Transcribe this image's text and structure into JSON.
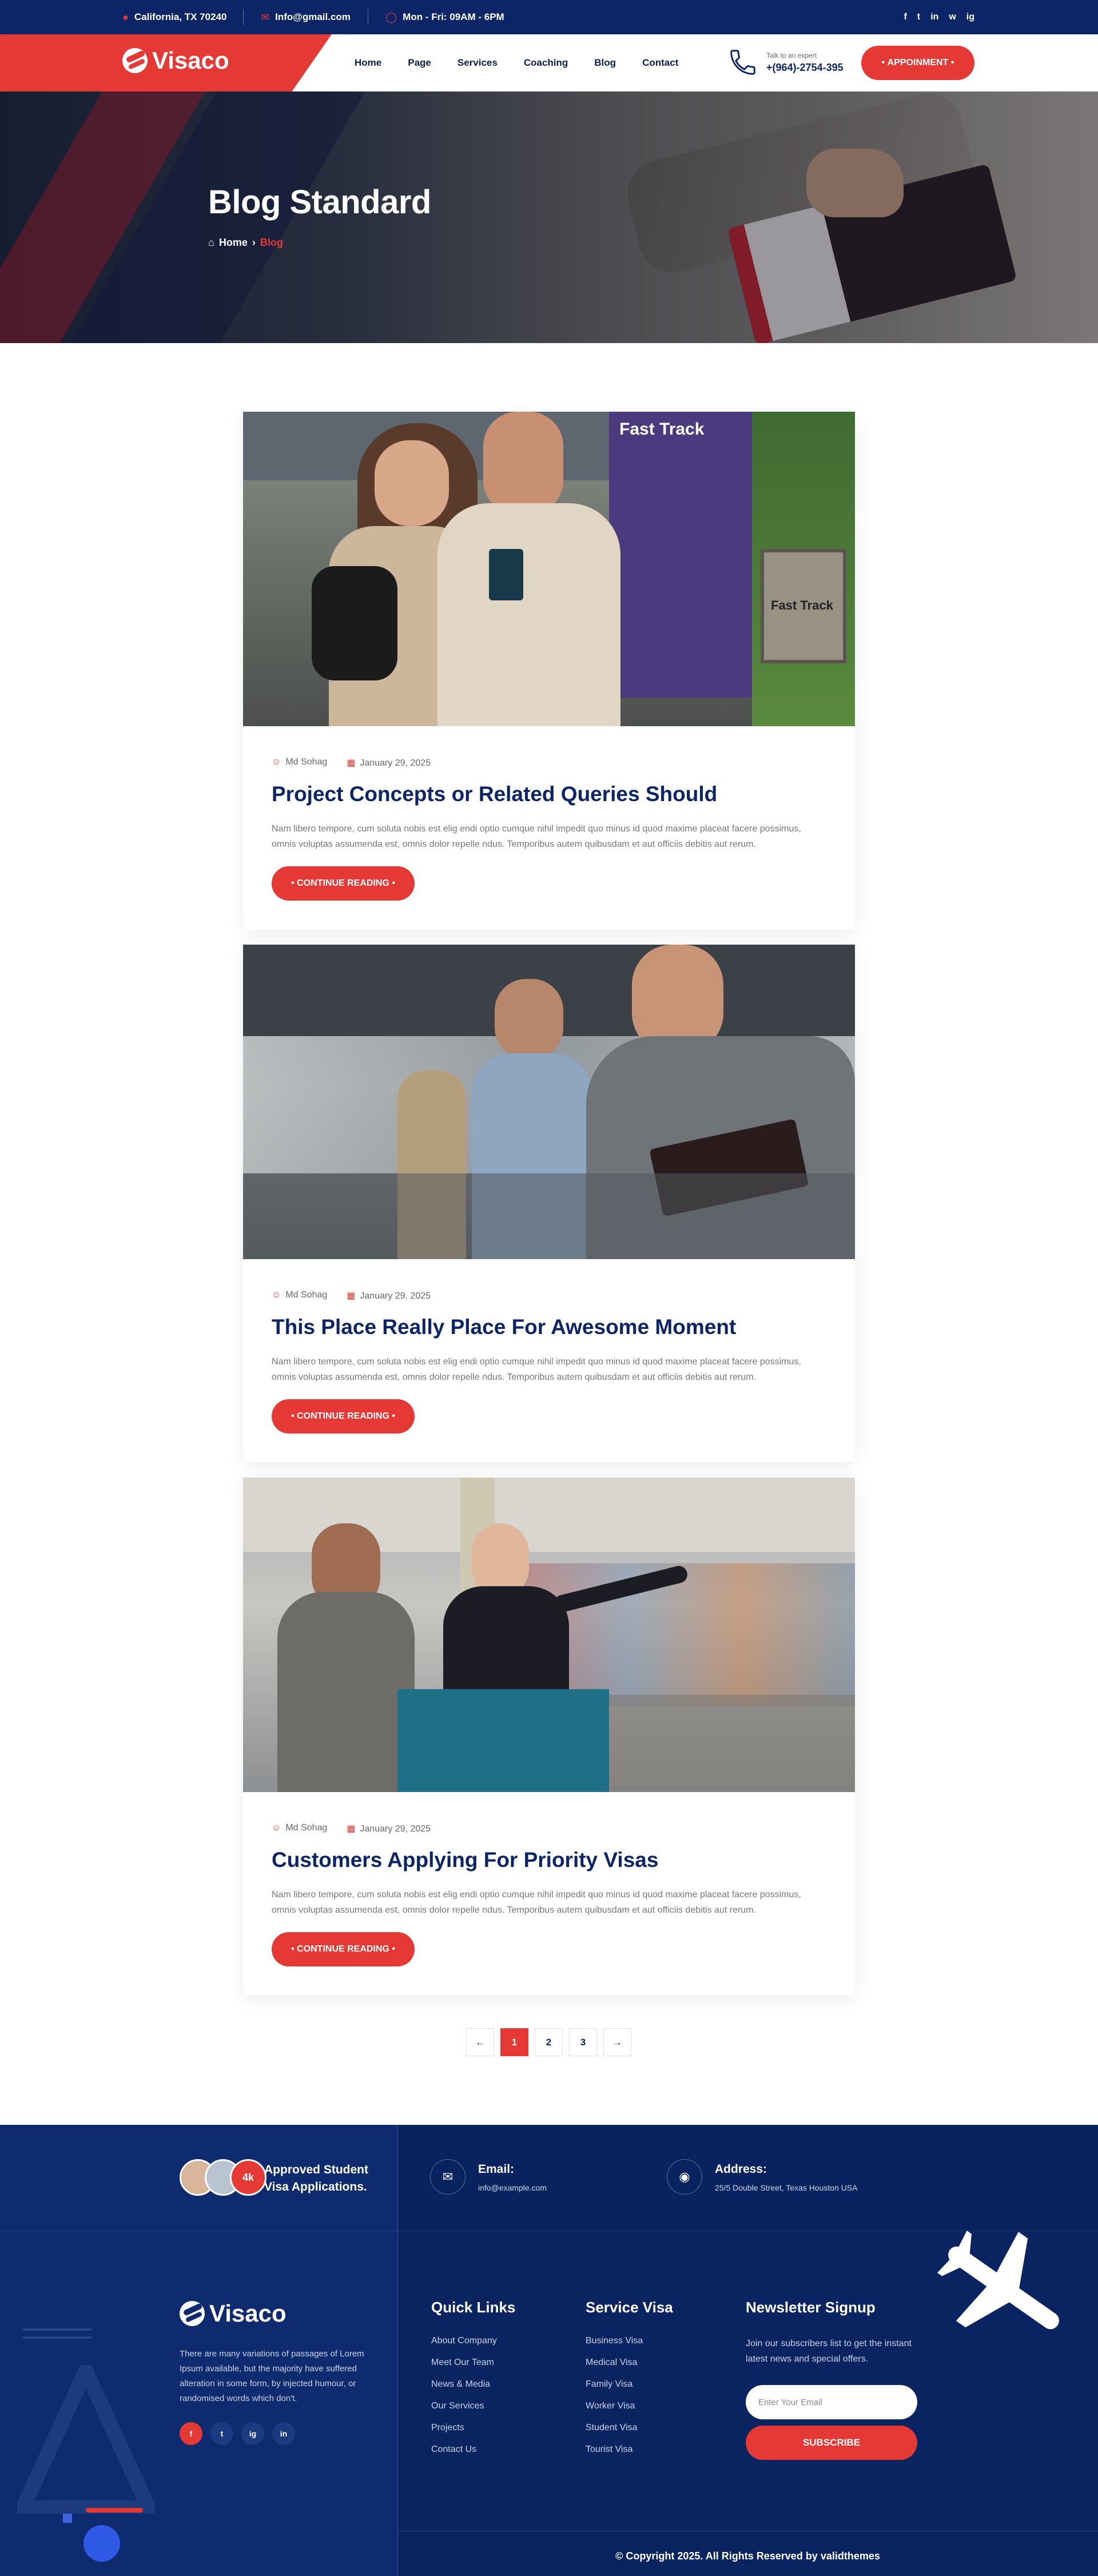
{
  "topbar": {
    "location": "California, TX 70240",
    "email": "Info@gmail.com",
    "hours": "Mon - Fri: 09AM - 6PM",
    "socials": [
      "f",
      "t",
      "in",
      "w",
      "ig"
    ]
  },
  "header": {
    "logo": "Visaco",
    "nav": [
      "Home",
      "Page",
      "Services",
      "Coaching",
      "Blog",
      "Contact"
    ],
    "expert_label": "Talk to an expert",
    "expert_phone": "+(964)-2754-395",
    "appointment": "APPOINMENT"
  },
  "banner": {
    "title": "Blog Standard",
    "breadcrumb_home": "Home",
    "breadcrumb_current": "Blog"
  },
  "posts": [
    {
      "author": "Md Sohag",
      "date": "January 29, 2025",
      "title": "Project Concepts or Related Queries Should",
      "excerpt": "Nam libero tempore, cum soluta nobis est elig endi optio cumque nihil impedit quo minus id quod maxime placeat facere possimus, omnis voluptas assumenda est, omnis dolor repelle ndus. Temporibus autem quibusdam et aut officiis debitis aut rerum.",
      "button": "CONTINUE READING"
    },
    {
      "author": "Md Sohag",
      "date": "January 29, 2025",
      "title": "This Place Really Place For Awesome Moment",
      "excerpt": "Nam libero tempore, cum soluta nobis est elig endi optio cumque nihil impedit quo minus id quod maxime placeat facere possimus, omnis voluptas assumenda est, omnis dolor repelle ndus. Temporibus autem quibusdam et aut officiis debitis aut rerum.",
      "button": "CONTINUE READING"
    },
    {
      "author": "Md Sohag",
      "date": "January 29, 2025",
      "title": "Customers Applying For Priority Visas",
      "excerpt": "Nam libero tempore, cum soluta nobis est elig endi optio cumque nihil impedit quo minus id quod maxime placeat facere possimus, omnis voluptas assumenda est, omnis dolor repelle ndus. Temporibus autem quibusdam et aut officiis debitis aut rerum.",
      "button": "CONTINUE READING"
    }
  ],
  "image_text": {
    "fast_track_sign": "Fast Track",
    "fast_track_small": "Fast Track"
  },
  "pagination": {
    "prev": "←",
    "pages": [
      "1",
      "2",
      "3"
    ],
    "active": "1",
    "next": "→"
  },
  "footer": {
    "students_count": "4k",
    "approved": "Approved Student Visa Applications.",
    "email_label": "Email:",
    "email_value": "info@example.com",
    "address_label": "Address:",
    "address_value": "25/5 Double Street, Texas Houston USA",
    "logo": "Visaco",
    "about": "There are many variations of passages of Lorem Ipsum available, but the majority have suffered alteration in some form, by injected humour, or randomised words which don't.",
    "quick_links_title": "Quick Links",
    "quick_links": [
      "About Company",
      "Meet Our Team",
      "News & Media",
      "Our Services",
      "Projects",
      "Contact Us"
    ],
    "service_title": "Service Visa",
    "services": [
      "Business Visa",
      "Medical Visa",
      "Family Visa",
      "Worker Visa",
      "Student Visa",
      "Tourist Visa"
    ],
    "newsletter_title": "Newsletter Signup",
    "newsletter_text": "Join our subscribers list to get the instant latest news and special offers.",
    "newsletter_placeholder": "Enter Your Email",
    "subscribe": "SUBSCRIBE",
    "copyright": "© Copyright 2025. All Rights Reserved by validthemes",
    "socials": [
      "f",
      "t",
      "ig",
      "in"
    ]
  },
  "colors": {
    "primary": "#e53935",
    "navy": "#0b2566",
    "footer_bg": "#0a2462"
  }
}
